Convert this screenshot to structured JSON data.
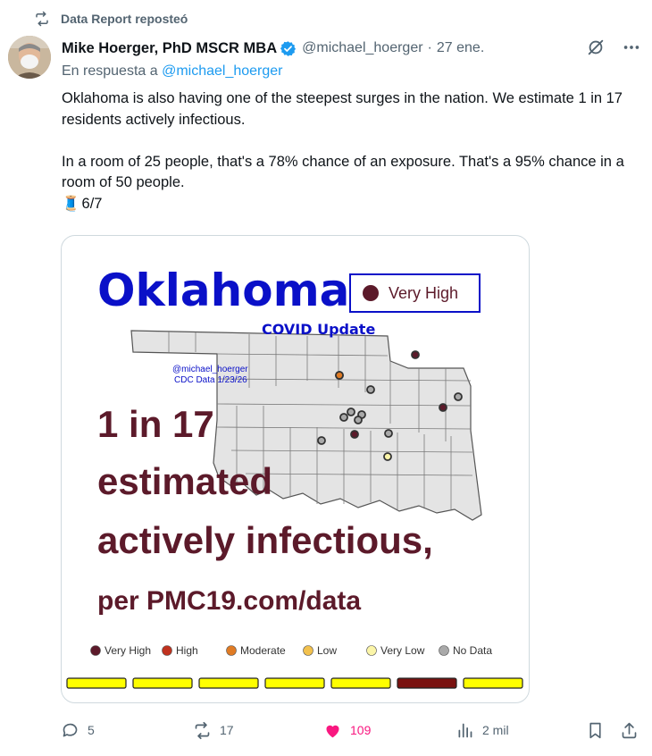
{
  "repost": {
    "label": "Data Report reposteó"
  },
  "tweet": {
    "author_name": "Mike Hoerger, PhD MSCR MBA",
    "handle": "@michael_hoerger",
    "separator": "·",
    "date": "27 ene.",
    "reply_prefix": "En respuesta a",
    "reply_handle": "@michael_hoerger",
    "text_para1": "Oklahoma is also having one of the steepest surges in the nation. We estimate 1 in 17 residents actively infectious.",
    "text_para2": "In a room of 25 people, that's a 78% chance of an exposure. That's a 95% chance in a room of 50 people.",
    "thread_marker": "🧵",
    "thread_count": "6/7"
  },
  "media": {
    "state_title": "Oklahoma",
    "risk_badge": "Very High",
    "subtitle": "COVID Update",
    "credit_handle": "@michael_hoerger",
    "credit_source": "CDC Data 1/23/26",
    "headline_1": "1 in 17",
    "headline_2": "estimated",
    "headline_3": "actively infectious,",
    "headline_4": "per PMC19.com/data",
    "legend": [
      {
        "label": "Very High",
        "color": "#5c1a2a"
      },
      {
        "label": "High",
        "color": "#c0321f"
      },
      {
        "label": "Moderate",
        "color": "#e07b24"
      },
      {
        "label": "Low",
        "color": "#f2c14e"
      },
      {
        "label": "Very Low",
        "color": "#fbf5a8"
      },
      {
        "label": "No Data",
        "color": "#a9a9a9"
      }
    ],
    "trend_bar_colors": [
      "#ffff00",
      "#ffff00",
      "#ffff00",
      "#ffff00",
      "#ffff00",
      "#7a1210",
      "#ffff00"
    ],
    "colors": {
      "title_blue": "#0a10c8",
      "headline_maroon": "#5c1a2a",
      "map_fill": "#e4e4e4"
    }
  },
  "actions": {
    "replies": "5",
    "reposts": "17",
    "likes": "109",
    "views": "2 mil"
  },
  "colors": {
    "secondary_text": "#536471",
    "link": "#1d9bf0",
    "like": "#f91880"
  }
}
